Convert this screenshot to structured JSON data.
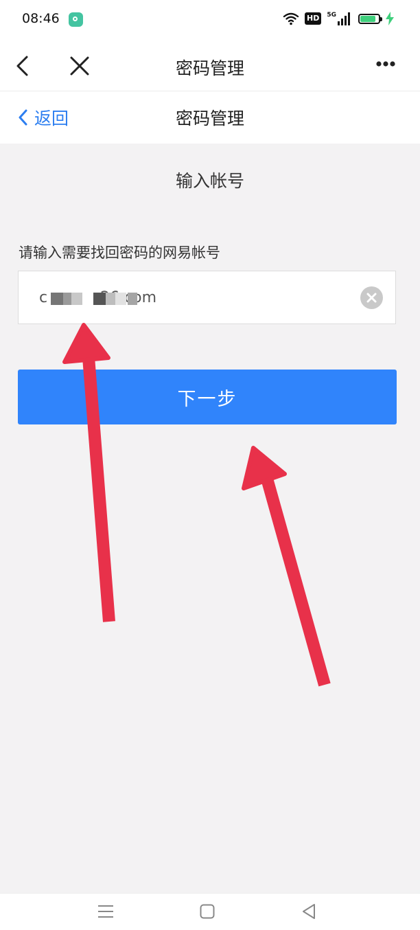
{
  "status_bar": {
    "time": "08:46",
    "hd_badge": "HD",
    "network": "5G",
    "battery_level": 0.85,
    "icons": [
      "app-notification-icon",
      "wifi-icon",
      "hd-icon",
      "cellular-signal-icon",
      "battery-icon",
      "charging-icon"
    ]
  },
  "browser_bar": {
    "title": "密码管理",
    "icons": [
      "back-icon",
      "close-icon",
      "more-icon"
    ]
  },
  "page_header": {
    "back_label": "返回",
    "title": "密码管理"
  },
  "form": {
    "section_title": "输入帐号",
    "field_label": "请输入需要找回密码的网易帐号",
    "account_value": "c           26.com",
    "next_button_label": "下一步"
  },
  "colors": {
    "accent_blue": "#3084fb",
    "link_blue": "#2c7ef0",
    "annotation_red": "#e8314a",
    "background": "#f3f2f3"
  },
  "nav_bar": {
    "icons": [
      "menu-icon",
      "home-icon",
      "back-triangle-icon"
    ]
  }
}
